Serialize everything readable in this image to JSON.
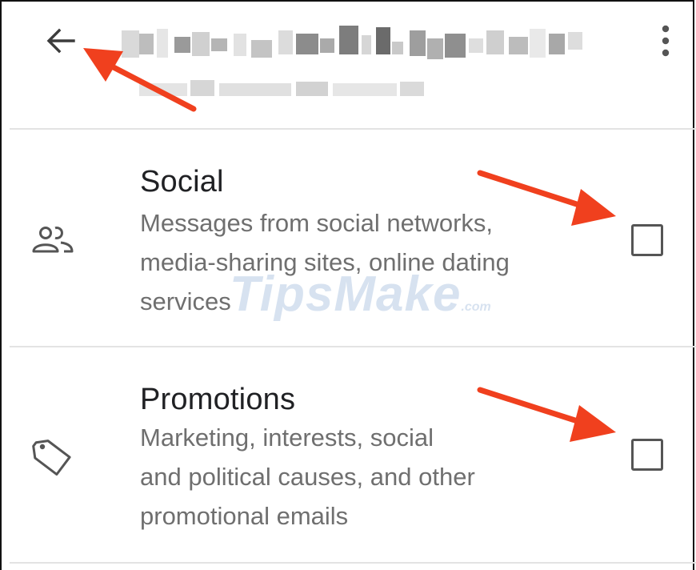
{
  "appbar": {
    "back_icon": "arrow-back-icon",
    "menu_icon": "more-vert-icon"
  },
  "categories": [
    {
      "label": "Social",
      "description": "Messages from social networks,\nmedia-sharing sites, online dating\nservices",
      "icon": "people-icon",
      "checked": false
    },
    {
      "label": "Promotions",
      "description": "Marketing, interests, social\nand political causes, and other\npromotional emails",
      "icon": "tag-icon",
      "checked": false
    }
  ],
  "watermark": {
    "text": "TipsMake",
    "suffix": ".com"
  },
  "colors": {
    "annotation_arrow": "#f0401e",
    "label_text": "#202124",
    "description_text": "#6f6f6f",
    "divider": "#e3e3e3",
    "checkbox_border": "#555555"
  }
}
